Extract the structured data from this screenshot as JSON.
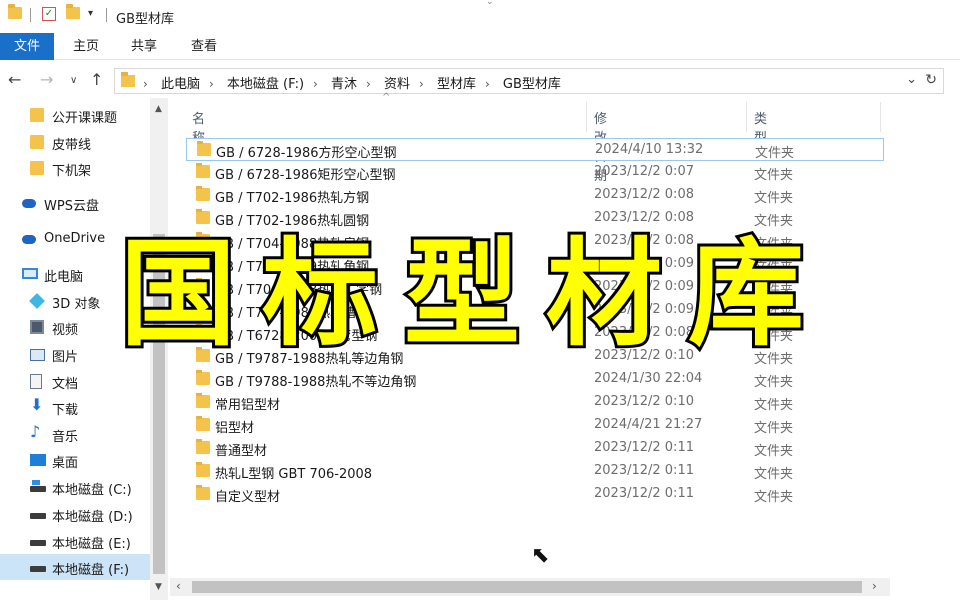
{
  "title_bar": {
    "title": "GB型材库"
  },
  "ribbon": {
    "tabs": [
      "文件",
      "主页",
      "共享",
      "查看"
    ]
  },
  "address": {
    "crumbs": [
      "此电脑",
      "本地磁盘 (F:)",
      "青沐",
      "资料",
      "型材库",
      "GB型材库"
    ]
  },
  "sidebar": {
    "items": [
      {
        "label": "公开课课题",
        "icon": "folder-icon"
      },
      {
        "label": "皮带线",
        "icon": "folder-icon"
      },
      {
        "label": "下机架",
        "icon": "folder-icon"
      },
      {
        "label": "WPS云盘",
        "icon": "cloud-icon"
      },
      {
        "label": "OneDrive",
        "icon": "cloud-icon"
      },
      {
        "label": "此电脑",
        "icon": "pc-icon"
      },
      {
        "label": "3D 对象",
        "icon": "3d-objects-icon"
      },
      {
        "label": "视频",
        "icon": "video-icon"
      },
      {
        "label": "图片",
        "icon": "pictures-icon"
      },
      {
        "label": "文档",
        "icon": "documents-icon"
      },
      {
        "label": "下载",
        "icon": "download-icon"
      },
      {
        "label": "音乐",
        "icon": "music-icon"
      },
      {
        "label": "桌面",
        "icon": "desktop-icon"
      },
      {
        "label": "本地磁盘 (C:)",
        "icon": "drive-icon"
      },
      {
        "label": "本地磁盘 (D:)",
        "icon": "drive-icon"
      },
      {
        "label": "本地磁盘 (E:)",
        "icon": "drive-icon"
      },
      {
        "label": "本地磁盘 (F:)",
        "icon": "drive-icon",
        "selected": true
      }
    ]
  },
  "columns": {
    "name": "名称",
    "date": "修改日期",
    "type": "类型"
  },
  "files": [
    {
      "name": "GB / 6728-1986方形空心型钢",
      "date": "2024/4/10 13:32",
      "type": "文件夹"
    },
    {
      "name": "GB / 6728-1986矩形空心型钢",
      "date": "2023/12/2 0:07",
      "type": "文件夹"
    },
    {
      "name": "GB / T702-1986热轧方钢",
      "date": "2023/12/2 0:08",
      "type": "文件夹"
    },
    {
      "name": "GB / T702-1986热轧圆钢",
      "date": "2023/12/2 0:08",
      "type": "文件夹"
    },
    {
      "name": "GB / T704-1988热轧扁钢",
      "date": "2023/12/2 0:08",
      "type": "文件夹"
    },
    {
      "name": "GB / T705-1989热轧角钢",
      "date": "2023/12/2 0:09",
      "type": "文件夹"
    },
    {
      "name": "GB / T706-1988热轧工字钢",
      "date": "2023/12/2 0:09",
      "type": "文件夹"
    },
    {
      "name": "GB / T707-1988热轧槽钢",
      "date": "2023/12/2 0:09",
      "type": "文件夹"
    },
    {
      "name": "GB / T6728-2002冷弯型钢",
      "date": "2023/12/2 0:08",
      "type": "文件夹"
    },
    {
      "name": "GB / T9787-1988热轧等边角钢",
      "date": "2023/12/2 0:10",
      "type": "文件夹"
    },
    {
      "name": "GB / T9788-1988热轧不等边角钢",
      "date": "2024/1/30 22:04",
      "type": "文件夹"
    },
    {
      "name": "常用铝型材",
      "date": "2023/12/2 0:10",
      "type": "文件夹"
    },
    {
      "name": "铝型材",
      "date": "2024/4/21 21:27",
      "type": "文件夹"
    },
    {
      "name": "普通型材",
      "date": "2023/12/2 0:11",
      "type": "文件夹"
    },
    {
      "name": "热轧L型钢 GBT 706-2008",
      "date": "2023/12/2 0:11",
      "type": "文件夹"
    },
    {
      "name": "自定义型材",
      "date": "2023/12/2 0:11",
      "type": "文件夹"
    }
  ],
  "overlay": {
    "text": "国标型材库",
    "color": "#ffff00",
    "stroke": "#000000"
  },
  "colors": {
    "accent": "#1a6fc9",
    "selection": "#cce4f7",
    "folder": "#f3c34b"
  }
}
